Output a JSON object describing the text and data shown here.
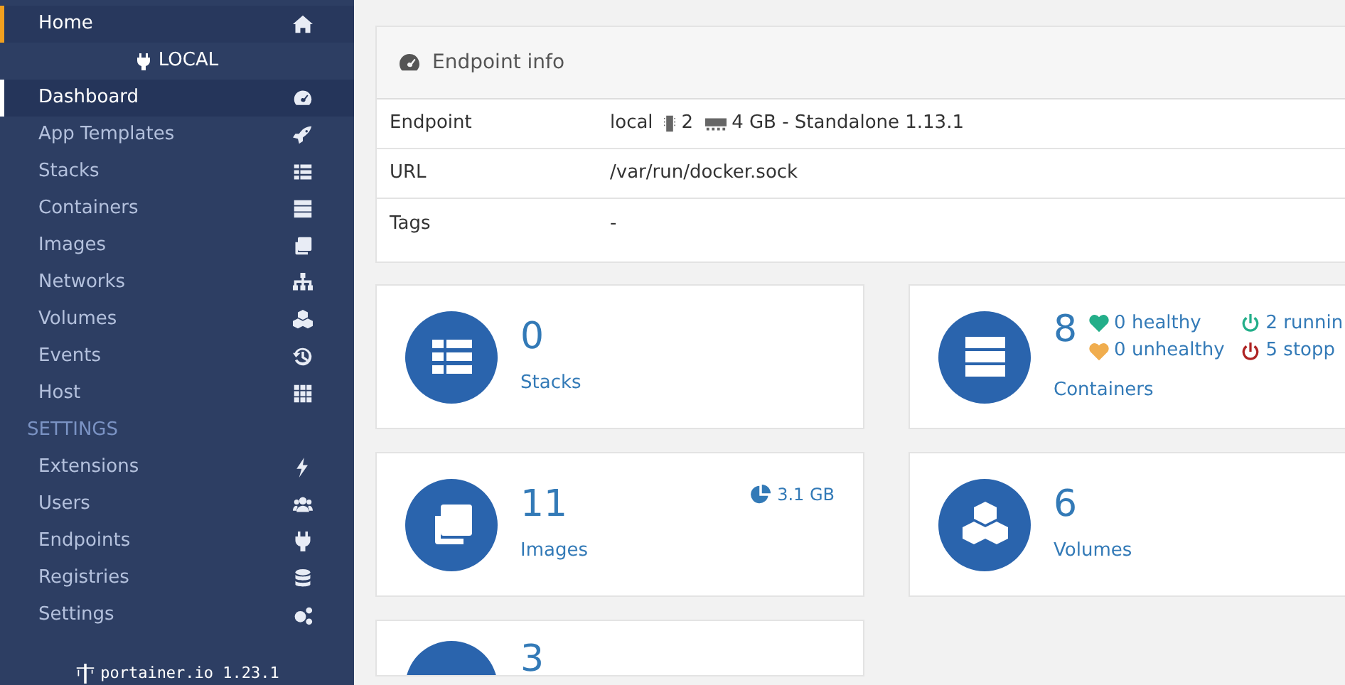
{
  "sidebar": {
    "home": {
      "label": "Home"
    },
    "endpoint_header": "LOCAL",
    "items": [
      {
        "label": "Dashboard",
        "selected": true
      },
      {
        "label": "App Templates",
        "selected": false
      },
      {
        "label": "Stacks",
        "selected": false
      },
      {
        "label": "Containers",
        "selected": false
      },
      {
        "label": "Images",
        "selected": false
      },
      {
        "label": "Networks",
        "selected": false
      },
      {
        "label": "Volumes",
        "selected": false
      },
      {
        "label": "Events",
        "selected": false
      },
      {
        "label": "Host",
        "selected": false
      }
    ],
    "section_title": "SETTINGS",
    "settings_items": [
      {
        "label": "Extensions",
        "selected": false
      },
      {
        "label": "Users",
        "selected": false
      },
      {
        "label": "Endpoints",
        "selected": false
      },
      {
        "label": "Registries",
        "selected": false
      },
      {
        "label": "Settings",
        "selected": false
      }
    ],
    "footer": "portainer.io 1.23.1"
  },
  "endpoint_info": {
    "title": "Endpoint info",
    "rows": [
      {
        "kind": "endpoint",
        "label": "Endpoint",
        "name": "local",
        "cpus": "2",
        "memory": "4 GB - Standalone 1.13.1"
      },
      {
        "kind": "text",
        "label": "URL",
        "value": "/var/run/docker.sock"
      },
      {
        "kind": "text",
        "label": "Tags",
        "value": "-"
      }
    ]
  },
  "widgets": [
    {
      "count": "0",
      "label": "Stacks"
    },
    {
      "count": "8",
      "label": "Containers",
      "health": [
        {
          "kind": "healthy",
          "text": "0 healthy"
        },
        {
          "kind": "unhealthy",
          "text": "0 unhealthy"
        }
      ],
      "states": [
        {
          "kind": "running",
          "text": "2 runnin"
        },
        {
          "kind": "stopped",
          "text": "5 stopp"
        }
      ]
    },
    {
      "count": "11",
      "label": "Images",
      "size": "3.1 GB"
    },
    {
      "count": "6",
      "label": "Volumes"
    },
    {
      "count": "3"
    }
  ]
}
